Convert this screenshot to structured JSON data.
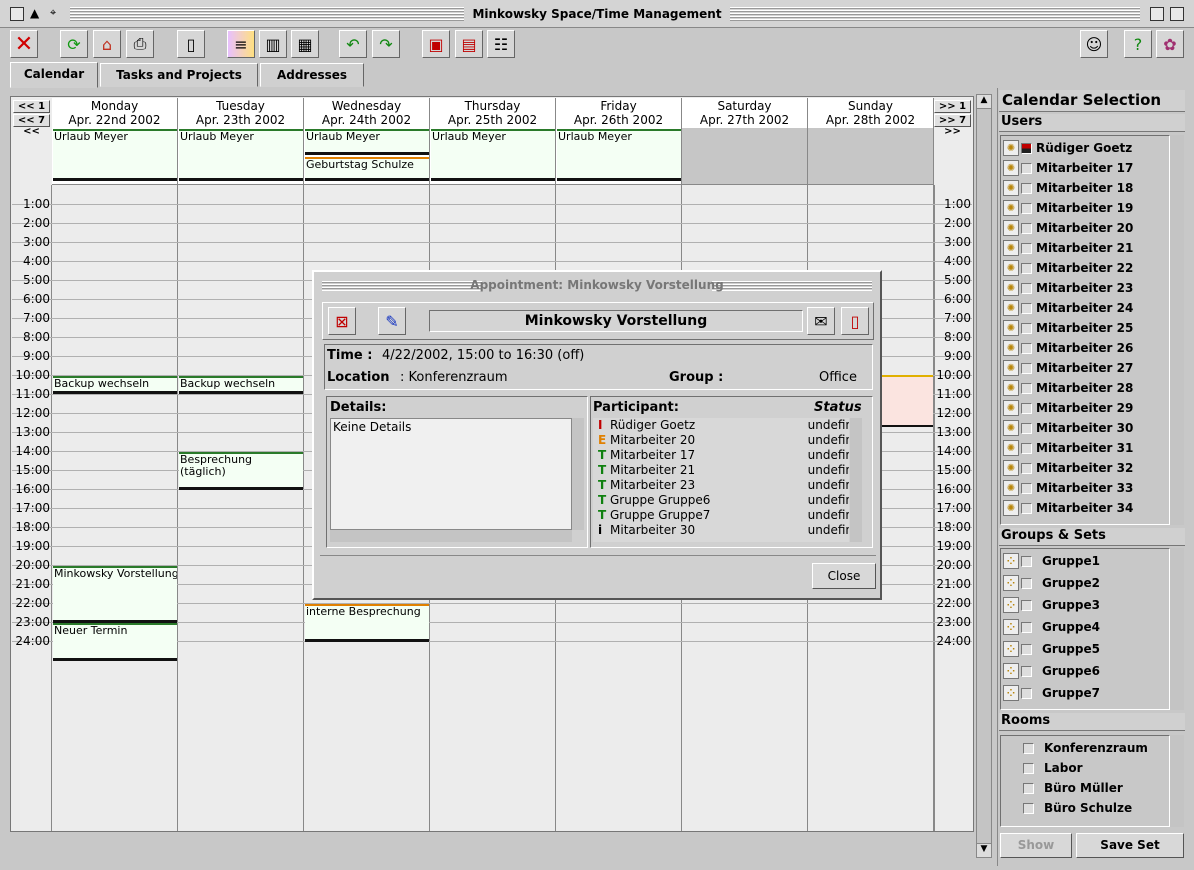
{
  "window": {
    "title": "Minkowsky Space/Time Management"
  },
  "tabs": [
    {
      "label": "Calendar"
    },
    {
      "label": "Tasks and Projects"
    },
    {
      "label": "Addresses"
    }
  ],
  "nav": {
    "prev_day": "<< 1 <<",
    "prev_week": "<< 7 <<",
    "next_day": ">> 1 >>",
    "next_week": ">> 7 >>"
  },
  "days": [
    {
      "name": "Monday",
      "date": "Apr. 22nd 2002"
    },
    {
      "name": "Tuesday",
      "date": "Apr. 23th 2002"
    },
    {
      "name": "Wednesday",
      "date": "Apr. 24th 2002"
    },
    {
      "name": "Thursday",
      "date": "Apr. 25th 2002"
    },
    {
      "name": "Friday",
      "date": "Apr. 26th 2002"
    },
    {
      "name": "Saturday",
      "date": "Apr. 27th 2002"
    },
    {
      "name": "Sunday",
      "date": "Apr. 28th 2002"
    }
  ],
  "hours": [
    "1:00",
    "2:00",
    "3:00",
    "4:00",
    "5:00",
    "6:00",
    "7:00",
    "8:00",
    "9:00",
    "10:00",
    "11:00",
    "12:00",
    "13:00",
    "14:00",
    "15:00",
    "16:00",
    "17:00",
    "18:00",
    "19:00",
    "20:00",
    "21:00",
    "22:00",
    "23:00",
    "24:00"
  ],
  "allday_events": {
    "urlaub": "Urlaub Meyer",
    "geburtstag": "Geburtstag Schulze"
  },
  "events": {
    "backup": "Backup wechseln",
    "besprechung_1": "Besprechung",
    "besprechung_2": "(täglich)",
    "minkowsky": "Minkowsky Vorstellung",
    "neuer": "Neuer Termin",
    "interne": "interne Besprechung"
  },
  "panel": {
    "title": "Calendar Selection",
    "users_header": "Users",
    "users": [
      "Rüdiger Goetz",
      "Mitarbeiter 17",
      "Mitarbeiter 18",
      "Mitarbeiter 19",
      "Mitarbeiter 20",
      "Mitarbeiter 21",
      "Mitarbeiter 22",
      "Mitarbeiter 23",
      "Mitarbeiter 24",
      "Mitarbeiter 25",
      "Mitarbeiter 26",
      "Mitarbeiter 27",
      "Mitarbeiter 28",
      "Mitarbeiter 29",
      "Mitarbeiter 30",
      "Mitarbeiter 31",
      "Mitarbeiter 32",
      "Mitarbeiter 33",
      "Mitarbeiter 34"
    ],
    "groups_header": "Groups & Sets",
    "groups": [
      "Gruppe1",
      "Gruppe2",
      "Gruppe3",
      "Gruppe4",
      "Gruppe5",
      "Gruppe6",
      "Gruppe7"
    ],
    "rooms_header": "Rooms",
    "rooms": [
      "Konferenzraum",
      "Labor",
      "Büro Müller",
      "Büro Schulze"
    ],
    "show_button": "Show",
    "save_button": "Save Set"
  },
  "dialog": {
    "title": "Appointment: Minkowsky Vorstellung",
    "subject": "Minkowsky Vorstellung",
    "time_label": "Time  :",
    "time_value": "4/22/2002, 15:00 to  16:30 (off)",
    "location_label": "Location",
    "location_value": ": Konferenzraum",
    "group_label": "Group :",
    "group_value": "Office",
    "details_label": "Details:",
    "details_value": "Keine Details",
    "participant_label": "Participant:",
    "status_label": "Status",
    "participants": [
      {
        "flag": "I",
        "color": "#c00000",
        "name": "Rüdiger Goetz",
        "status": "undefin"
      },
      {
        "flag": "E",
        "color": "#e08000",
        "name": "Mitarbeiter 20",
        "status": "undefin"
      },
      {
        "flag": "T",
        "color": "#108010",
        "name": "Mitarbeiter 17",
        "status": "undefin"
      },
      {
        "flag": "T",
        "color": "#108010",
        "name": "Mitarbeiter 21",
        "status": "undefin"
      },
      {
        "flag": "T",
        "color": "#108010",
        "name": "Mitarbeiter 23",
        "status": "undefin"
      },
      {
        "flag": "T",
        "color": "#108010",
        "name": "Gruppe Gruppe6",
        "status": "undefin"
      },
      {
        "flag": "T",
        "color": "#108010",
        "name": "Gruppe Gruppe7",
        "status": "undefin"
      },
      {
        "flag": "i",
        "color": "#000000",
        "name": "Mitarbeiter 30",
        "status": "undefin"
      }
    ],
    "close_button": "Close"
  }
}
